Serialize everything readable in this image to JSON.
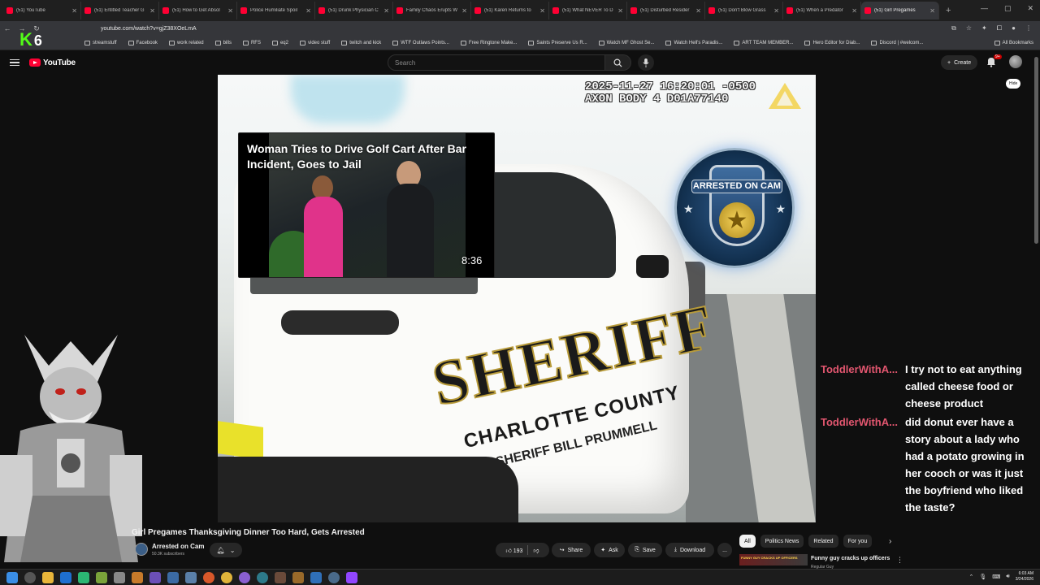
{
  "browser": {
    "tabs": [
      {
        "label": "(51) YouTube"
      },
      {
        "label": "(51) Entitled Teacher G"
      },
      {
        "label": "(51) How to Get Absol"
      },
      {
        "label": "Police Humiliate Spoil"
      },
      {
        "label": "(51) Drunk Physician C"
      },
      {
        "label": "Family Chaos Erupts W"
      },
      {
        "label": "(51) Karen Returns to"
      },
      {
        "label": "(51) What NEVER To D"
      },
      {
        "label": "(51) Disturbed Resider"
      },
      {
        "label": "(51) Don't Blow Grass"
      },
      {
        "label": "(51) When a Predator"
      },
      {
        "label": "(51) Girl Pregames"
      }
    ],
    "new_tab": "+",
    "window_controls": {
      "minimize": "—",
      "maximize": "▢",
      "close": "✕"
    },
    "url": "youtube.com/watch?v=gjZ38XOeLmA",
    "bookmarks": [
      {
        "label": "streamstuff"
      },
      {
        "label": "Facebook"
      },
      {
        "label": "work related"
      },
      {
        "label": "bills"
      },
      {
        "label": "RFS"
      },
      {
        "label": "eq2"
      },
      {
        "label": "video stuff"
      },
      {
        "label": "twitch and kick"
      },
      {
        "label": "WTF Outlaws Points..."
      },
      {
        "label": "Free Ringtone Make..."
      },
      {
        "label": "Saints Preserve Us R..."
      },
      {
        "label": "Watch MF Ghost Se..."
      },
      {
        "label": "Watch Hell's Paradis..."
      },
      {
        "label": "ART TEAM MEMBER..."
      },
      {
        "label": "Hero Editor for Diab..."
      },
      {
        "label": "Discord | #welcom..."
      }
    ],
    "all_bookmarks": "All Bookmarks"
  },
  "overlay": {
    "kick_logo_letter": "K",
    "kick_count": "6"
  },
  "youtube": {
    "logo_text": "YouTube",
    "search_placeholder": "Search",
    "create_label": "Create",
    "notif_badge": "9+",
    "hide_label": "Hide"
  },
  "player": {
    "timestamp_line1": "2025-11-27 16:20:01 -0500",
    "timestamp_line2": "AXON BODY 4 D01A77140",
    "car_text": "SHERIFF",
    "car_county": "CHARLOTTE COUNTY",
    "car_sheriff_name": "SHERIFF BILL PRUMMELL",
    "channel_badge": "ARRESTED ON CAM",
    "preview_title": "Woman Tries to Drive Golf Cart After Bar Incident, Goes to Jail",
    "preview_duration": "8:36"
  },
  "chat": [
    {
      "user": "ToddlerWithA...",
      "text": "I try not to eat anything called cheese food or cheese product"
    },
    {
      "user": "ToddlerWithA...",
      "text": "did donut ever have a story about a lady who had a potato growing in her cooch or was it just the boyfriend who liked the taste?"
    }
  ],
  "video": {
    "title": "Girl Pregames Thanksgiving Dinner Too Hard, Gets Arrested",
    "channel": "Arrested on Cam",
    "subscribers": "50.3K subscribers",
    "likes": "193",
    "share": "Share",
    "ask": "Ask",
    "save": "Save",
    "download": "Download",
    "more": "..."
  },
  "recommendations": {
    "chips": [
      "All",
      "Politics News",
      "Related",
      "For you"
    ],
    "first_title": "Funny guy cracks up officers",
    "first_channel": "Regular Guy",
    "first_thumb_text": "FUNNY GUY CRACKS UP OFFICERS"
  },
  "taskbar": {
    "clock_time": "6:03 AM",
    "clock_date": "3/24/2026"
  },
  "colors": {
    "youtube_red": "#ff0033",
    "chat_user": "#e2566f",
    "kick_green": "#53fc18"
  }
}
